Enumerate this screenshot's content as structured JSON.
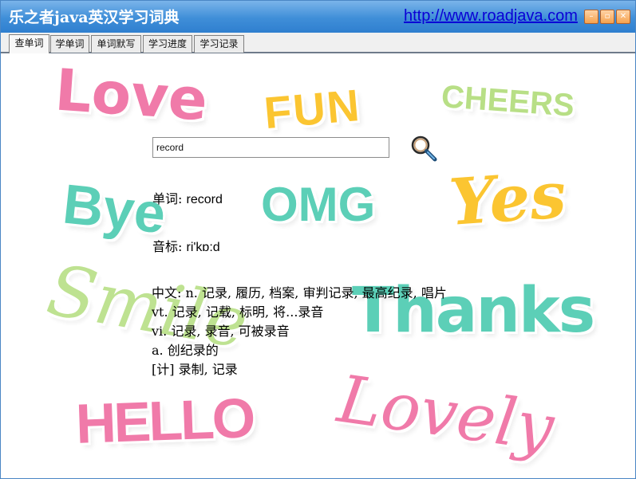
{
  "window": {
    "title": "乐之者java英汉学习词典",
    "link": "http://www.roadjava.com",
    "buttons": [
      "–",
      "▫",
      "✕"
    ]
  },
  "tabs": [
    {
      "label": "查单词",
      "active": true
    },
    {
      "label": "学单词",
      "active": false
    },
    {
      "label": "单词默写",
      "active": false
    },
    {
      "label": "学习进度",
      "active": false
    },
    {
      "label": "学习记录",
      "active": false
    }
  ],
  "search": {
    "value": "record"
  },
  "result": {
    "word_label": "单词: ",
    "word": "record",
    "phonetic_label": "音标: ",
    "phonetic": "ri'kɒ:d",
    "cn_label": "中文: ",
    "definitions": [
      {
        "pos": "n.",
        "text": " 记录, 履历, 档案, 审判记录, 最高纪录, 唱片"
      },
      {
        "pos": "vt.",
        "text": " 记录, 记载, 标明, 将...录音"
      },
      {
        "pos": "vi.",
        "text": " 记录, 录音, 可被录音"
      },
      {
        "pos": "a.",
        "text": " 创纪录的"
      },
      {
        "pos": "[计]",
        "text": " 录制, 记录"
      }
    ]
  },
  "background_words": [
    "Love",
    "FUN",
    "CHEERS",
    "Bye",
    "OMG",
    "Yes",
    "Smile",
    "Thanks",
    "HELLO",
    "Lovely"
  ],
  "colors": {
    "title_bar": "#3f8ed8",
    "link": "#0a00d6",
    "pink": "#f07aa9",
    "yellow": "#fbc531",
    "green": "#b8df86",
    "teal": "#5ccfb7"
  }
}
